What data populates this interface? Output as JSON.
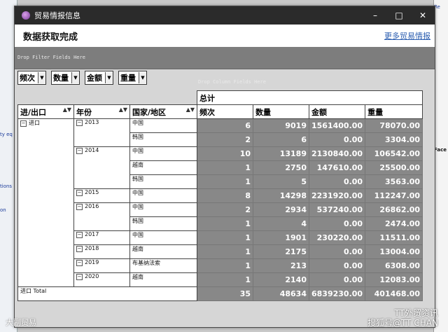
{
  "window": {
    "title": "贸易情报信息",
    "min": "–",
    "max": "□",
    "close": "✕"
  },
  "header": {
    "title": "数据获取完成",
    "link": "更多贸易情报"
  },
  "filter_zone": "Drop Filter Fields Here",
  "column_zone": "Drop Column Fields Here",
  "data_fields": [
    "频次",
    "数量",
    "金额",
    "重量"
  ],
  "row_fields": [
    "进/出口",
    "年份",
    "国家/地区"
  ],
  "total_label": "总计",
  "columns": [
    "频次",
    "数量",
    "金额",
    "重量"
  ],
  "rows": [
    {
      "dir": "进口",
      "year": "2013",
      "country": "中国",
      "v": [
        "6",
        "9019",
        "1561400.00",
        "78070.00"
      ]
    },
    {
      "dir": "",
      "year": "",
      "country": "韩国",
      "v": [
        "2",
        "6",
        "0.00",
        "3304.00"
      ]
    },
    {
      "dir": "",
      "year": "2014",
      "country": "中国",
      "v": [
        "10",
        "13189",
        "2130840.00",
        "106542.00"
      ]
    },
    {
      "dir": "",
      "year": "",
      "country": "越南",
      "v": [
        "1",
        "2750",
        "147610.00",
        "25500.00"
      ]
    },
    {
      "dir": "",
      "year": "",
      "country": "韩国",
      "v": [
        "1",
        "5",
        "0.00",
        "3563.00"
      ]
    },
    {
      "dir": "",
      "year": "2015",
      "country": "中国",
      "v": [
        "8",
        "14298",
        "2231920.00",
        "112247.00"
      ]
    },
    {
      "dir": "",
      "year": "2016",
      "country": "中国",
      "v": [
        "2",
        "2934",
        "537240.00",
        "26862.00"
      ]
    },
    {
      "dir": "",
      "year": "",
      "country": "韩国",
      "v": [
        "1",
        "4",
        "0.00",
        "2474.00"
      ]
    },
    {
      "dir": "",
      "year": "2017",
      "country": "中国",
      "v": [
        "1",
        "1901",
        "230220.00",
        "11511.00"
      ]
    },
    {
      "dir": "",
      "year": "2018",
      "country": "越南",
      "v": [
        "1",
        "2175",
        "0.00",
        "13004.00"
      ]
    },
    {
      "dir": "",
      "year": "2019",
      "country": "布基纳法索",
      "v": [
        "1",
        "213",
        "0.00",
        "6308.00"
      ]
    },
    {
      "dir": "",
      "year": "2020",
      "country": "越南",
      "v": [
        "1",
        "2140",
        "0.00",
        "12083.00"
      ]
    }
  ],
  "total_row": {
    "label": "进口 Total",
    "v": [
      "35",
      "48634",
      "6839230.00",
      "401468.00"
    ]
  },
  "watermarks": {
    "left": "大副贸易",
    "right_line1": "TT外贸资讯",
    "right_line2": "搜狐号@TT CHAN"
  },
  "background_fragments": [
    "Face",
    "Re",
    "ty eq",
    "tions",
    "on",
    "on"
  ]
}
